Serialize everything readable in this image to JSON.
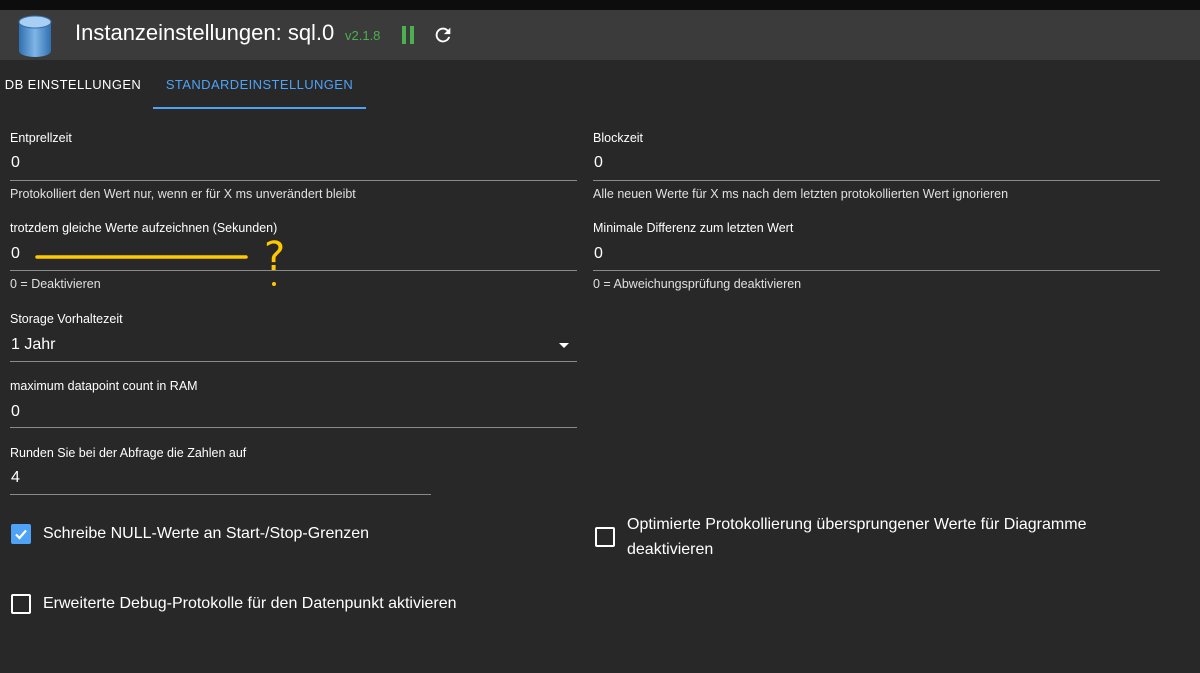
{
  "header": {
    "title": "Instanzeinstellungen: sql.0",
    "version": "v2.1.8",
    "icons": [
      "database-icon",
      "pause-icon",
      "refresh-icon"
    ],
    "accent_color": "#4caf50"
  },
  "tabs": [
    {
      "label": "DB EINSTELLUNGEN",
      "active": false
    },
    {
      "label": "STANDARDEINSTELLUNGEN",
      "active": true
    }
  ],
  "form": {
    "debounce": {
      "label": "Entprellzeit",
      "value": "0",
      "help": "Protokolliert den Wert nur, wenn er für X ms unverändert bleibt"
    },
    "block": {
      "label": "Blockzeit",
      "value": "0",
      "help": "Alle neuen Werte für X ms nach dem letzten protokollierten Wert ignorieren"
    },
    "same_values": {
      "label": "trotzdem gleiche Werte aufzeichnen (Sekunden)",
      "value": "0",
      "help": "0 = Deaktivieren"
    },
    "min_diff": {
      "label": "Minimale Differenz zum letzten Wert",
      "value": "0",
      "help": "0 = Abweichungsprüfung deaktivieren"
    },
    "retention": {
      "label": "Storage Vorhaltezeit",
      "value": "1 Jahr"
    },
    "max_ram": {
      "label": "maximum datapoint count in RAM",
      "value": "0"
    },
    "round": {
      "label": "Runden Sie bei der Abfrage die Zahlen auf",
      "value": "4"
    }
  },
  "checkboxes": {
    "null_values": {
      "label": "Schreibe NULL-Werte an Start-/Stop-Grenzen",
      "checked": true
    },
    "optimized_logging": {
      "label": "Optimierte Protokollierung übersprungener Werte für Diagramme deaktivieren",
      "checked": false
    },
    "debug_logs": {
      "label": "Erweiterte Debug-Protokolle für den Datenpunkt aktivieren",
      "checked": false
    }
  },
  "annotation": {
    "mark": "?",
    "color": "#ffc800"
  }
}
